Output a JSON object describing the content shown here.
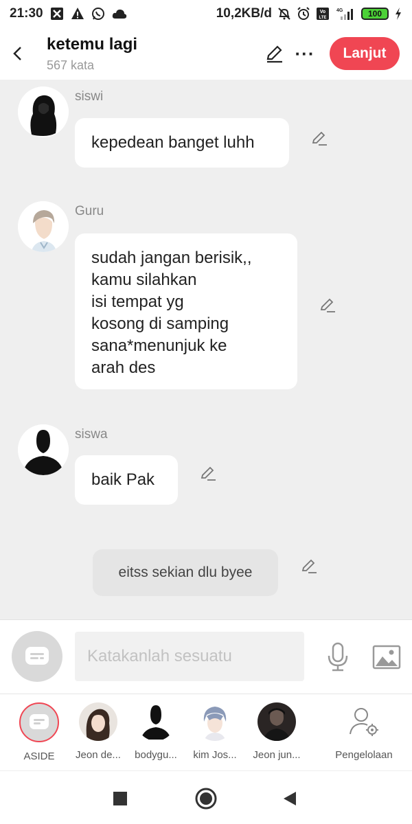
{
  "status_bar": {
    "time": "21:30",
    "net_speed": "10,2KB/d",
    "battery": "100",
    "icons": [
      "app-icon",
      "warning-icon",
      "whatsapp-icon",
      "cloud-icon",
      "mute-icon",
      "alarm-icon",
      "volte-icon",
      "signal-icon",
      "charging-icon"
    ]
  },
  "header": {
    "title": "ketemu lagi",
    "subtitle": "567 kata",
    "next_label": "Lanjut",
    "more_label": "···",
    "accent": "#f04653"
  },
  "messages": [
    {
      "speaker": "siswi",
      "lines": [
        "kepedean banget luhh"
      ]
    },
    {
      "speaker": "Guru",
      "lines": [
        "sudah jangan berisik,,",
        "kamu silahkan",
        "isi tempat yg",
        "kosong di samping",
        "sana*menunjuk ke",
        "arah des"
      ]
    },
    {
      "speaker": "siswa",
      "lines": [
        "baik Pak"
      ]
    }
  ],
  "aside_message": "eitss sekian dlu byee",
  "input": {
    "placeholder": "Katakanlah sesuatu"
  },
  "characters": [
    {
      "label": "ASIDE"
    },
    {
      "label": "Jeon de..."
    },
    {
      "label": "bodygu..."
    },
    {
      "label": "kim Jos..."
    },
    {
      "label": "Jeon jun..."
    }
  ],
  "management_label": "Pengelolaan"
}
